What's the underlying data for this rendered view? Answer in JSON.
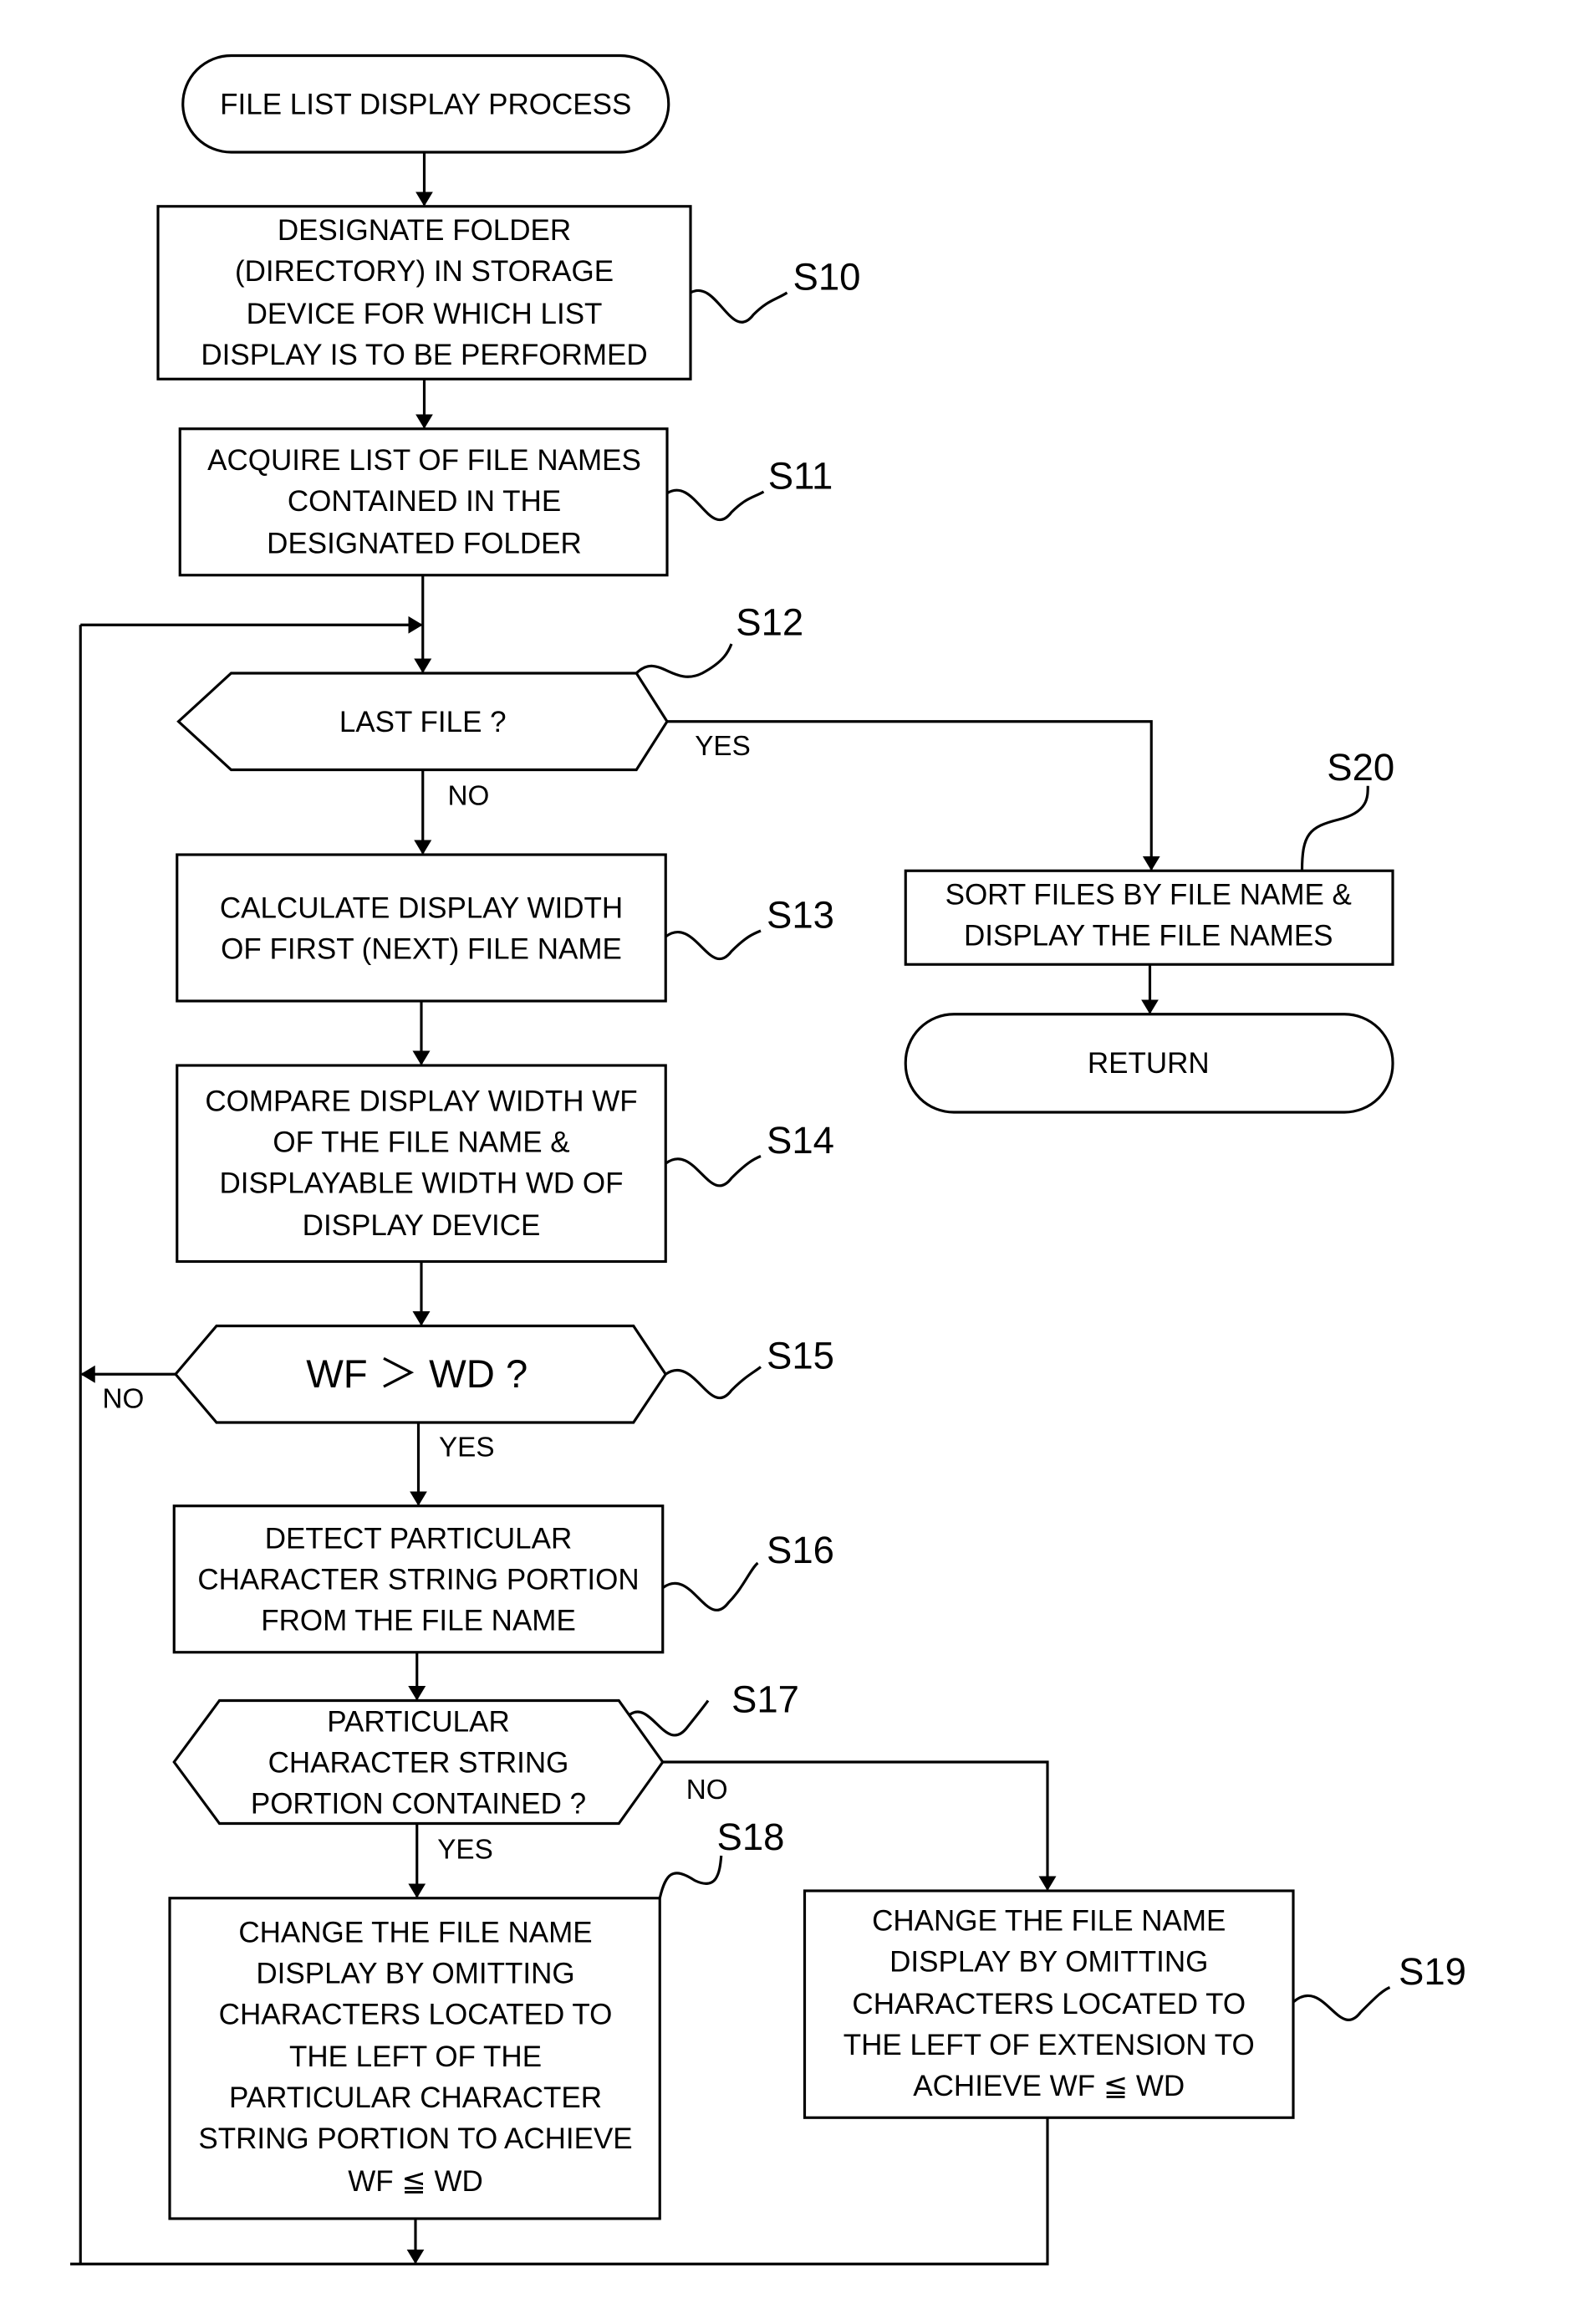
{
  "diagram": {
    "type": "flowchart",
    "start": {
      "label": "FILE LIST DISPLAY PROCESS"
    },
    "steps": {
      "S10": {
        "id": "S10",
        "lines": [
          "DESIGNATE FOLDER",
          "(DIRECTORY) IN STORAGE",
          "DEVICE FOR WHICH LIST",
          "DISPLAY IS TO BE PERFORMED"
        ]
      },
      "S11": {
        "id": "S11",
        "lines": [
          "ACQUIRE LIST OF FILE NAMES",
          "CONTAINED IN THE",
          "DESIGNATED FOLDER"
        ]
      },
      "S12": {
        "id": "S12",
        "lines": [
          "LAST FILE ?"
        ],
        "yes": "YES",
        "no": "NO"
      },
      "S13": {
        "id": "S13",
        "lines": [
          "CALCULATE DISPLAY WIDTH",
          "OF FIRST (NEXT) FILE NAME"
        ]
      },
      "S14": {
        "id": "S14",
        "lines": [
          "COMPARE DISPLAY WIDTH WF",
          "OF THE FILE NAME &",
          "DISPLAYABLE WIDTH WD OF",
          "DISPLAY DEVICE"
        ]
      },
      "S15": {
        "id": "S15",
        "lines": [
          "WF ＞ WD ?"
        ],
        "yes": "YES",
        "no": "NO"
      },
      "S16": {
        "id": "S16",
        "lines": [
          "DETECT PARTICULAR",
          "CHARACTER STRING PORTION",
          "FROM THE FILE NAME"
        ]
      },
      "S17": {
        "id": "S17",
        "lines": [
          "PARTICULAR",
          "CHARACTER STRING",
          "PORTION CONTAINED ?"
        ],
        "yes": "YES",
        "no": "NO"
      },
      "S18": {
        "id": "S18",
        "lines": [
          "CHANGE THE FILE NAME",
          "DISPLAY BY OMITTING",
          "CHARACTERS LOCATED TO",
          "THE LEFT OF THE",
          "PARTICULAR CHARACTER",
          "STRING PORTION TO ACHIEVE",
          "WF ≦ WD"
        ]
      },
      "S19": {
        "id": "S19",
        "lines": [
          "CHANGE THE FILE NAME",
          "DISPLAY BY OMITTING",
          "CHARACTERS LOCATED TO",
          "THE LEFT OF EXTENSION TO",
          "ACHIEVE WF ≦ WD"
        ]
      },
      "S20": {
        "id": "S20",
        "lines": [
          "SORT FILES BY FILE NAME &",
          "DISPLAY THE FILE NAMES"
        ]
      }
    },
    "end": {
      "label": "RETURN"
    }
  }
}
